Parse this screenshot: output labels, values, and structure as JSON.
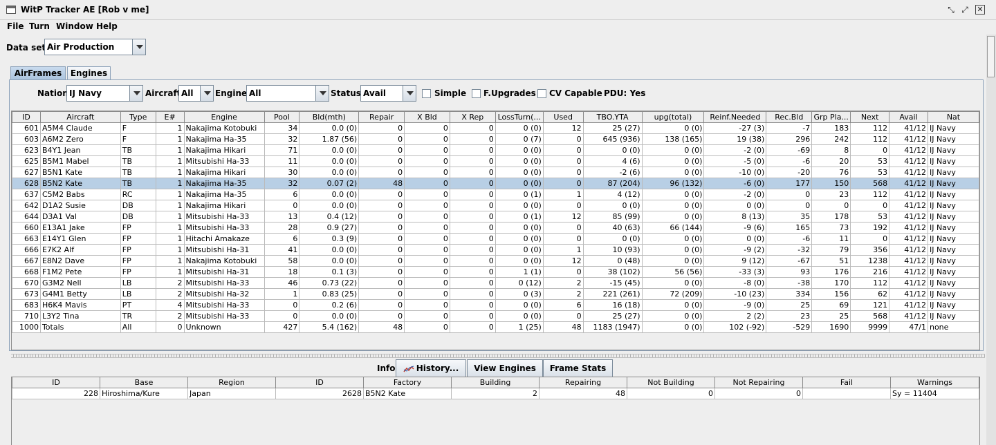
{
  "window": {
    "title": "WitP Tracker AE [Rob v me]"
  },
  "menu": [
    "File",
    "Turn",
    "Window",
    "Help"
  ],
  "dataset": {
    "label": "Data set:",
    "value": "Air Production"
  },
  "tabs": [
    {
      "label": "AirFrames",
      "active": true
    },
    {
      "label": "Engines",
      "active": false
    }
  ],
  "filters": {
    "nation_label": "Nation:",
    "nation_value": "IJ Navy",
    "aircraft_label": "Aircraft:",
    "aircraft_value": "All",
    "engine_label": "Engine:",
    "engine_value": "All",
    "status_label": "Status:",
    "status_value": "Avail",
    "simple_label": "Simple",
    "simple_checked": false,
    "fupgrades_label": "F.Upgrades",
    "fupgrades_checked": false,
    "cvcapable_label": "CV Capable",
    "cvcapable_checked": false,
    "pdu_label": "PDU: Yes"
  },
  "table": {
    "columns": [
      "ID",
      "Aircraft",
      "Type",
      "E#",
      "Engine",
      "Pool",
      "Bld(mth)",
      "Repair",
      "X Bld",
      "X Rep",
      "LossTurn(...",
      "Used",
      "TBO.YTA",
      "upg(total)",
      "Reinf.Needed",
      "Rec.Bld",
      "Grp Pla...",
      "Next",
      "Avail",
      "Nat"
    ],
    "selected_row": 5,
    "rows": [
      [
        "601",
        "A5M4 Claude",
        "F",
        "1",
        "Nakajima Kotobuki",
        "34",
        "0.0 (0)",
        "0",
        "0",
        "0",
        "0 (0)",
        "12",
        "25 (27)",
        "0 (0)",
        "-27 (3)",
        "-7",
        "183",
        "112",
        "41/12",
        "IJ Navy"
      ],
      [
        "603",
        "A6M2 Zero",
        "F",
        "1",
        "Nakajima Ha-35",
        "32",
        "1.87 (56)",
        "0",
        "0",
        "0",
        "0 (7)",
        "0",
        "645 (936)",
        "138 (165)",
        "19 (38)",
        "296",
        "242",
        "112",
        "41/12",
        "IJ Navy"
      ],
      [
        "623",
        "B4Y1 Jean",
        "TB",
        "1",
        "Nakajima Hikari",
        "71",
        "0.0 (0)",
        "0",
        "0",
        "0",
        "0 (0)",
        "0",
        "0 (0)",
        "0 (0)",
        "-2 (0)",
        "-69",
        "8",
        "0",
        "41/12",
        "IJ Navy"
      ],
      [
        "625",
        "B5M1 Mabel",
        "TB",
        "1",
        "Mitsubishi Ha-33",
        "11",
        "0.0 (0)",
        "0",
        "0",
        "0",
        "0 (0)",
        "0",
        "4 (6)",
        "0 (0)",
        "-5 (0)",
        "-6",
        "20",
        "53",
        "41/12",
        "IJ Navy"
      ],
      [
        "627",
        "B5N1 Kate",
        "TB",
        "1",
        "Nakajima Hikari",
        "30",
        "0.0 (0)",
        "0",
        "0",
        "0",
        "0 (0)",
        "0",
        "-2 (6)",
        "0 (0)",
        "-10 (0)",
        "-20",
        "76",
        "53",
        "41/12",
        "IJ Navy"
      ],
      [
        "628",
        "B5N2 Kate",
        "TB",
        "1",
        "Nakajima Ha-35",
        "32",
        "0.07 (2)",
        "48",
        "0",
        "0",
        "0 (0)",
        "0",
        "87 (204)",
        "96 (132)",
        "-6 (0)",
        "177",
        "150",
        "568",
        "41/12",
        "IJ Navy"
      ],
      [
        "637",
        "C5M2 Babs",
        "RC",
        "1",
        "Nakajima Ha-35",
        "6",
        "0.0 (0)",
        "0",
        "0",
        "0",
        "0 (1)",
        "1",
        "4 (12)",
        "0 (0)",
        "-2 (0)",
        "0",
        "23",
        "112",
        "41/12",
        "IJ Navy"
      ],
      [
        "642",
        "D1A2 Susie",
        "DB",
        "1",
        "Nakajima Hikari",
        "0",
        "0.0 (0)",
        "0",
        "0",
        "0",
        "0 (0)",
        "0",
        "0 (0)",
        "0 (0)",
        "0 (0)",
        "0",
        "0",
        "0",
        "41/12",
        "IJ Navy"
      ],
      [
        "644",
        "D3A1 Val",
        "DB",
        "1",
        "Mitsubishi Ha-33",
        "13",
        "0.4 (12)",
        "0",
        "0",
        "0",
        "0 (1)",
        "12",
        "85 (99)",
        "0 (0)",
        "8 (13)",
        "35",
        "178",
        "53",
        "41/12",
        "IJ Navy"
      ],
      [
        "660",
        "E13A1 Jake",
        "FP",
        "1",
        "Mitsubishi Ha-33",
        "28",
        "0.9 (27)",
        "0",
        "0",
        "0",
        "0 (0)",
        "0",
        "40 (63)",
        "66 (144)",
        "-9 (6)",
        "165",
        "73",
        "192",
        "41/12",
        "IJ Navy"
      ],
      [
        "663",
        "E14Y1 Glen",
        "FP",
        "1",
        "Hitachi Amakaze",
        "6",
        "0.3 (9)",
        "0",
        "0",
        "0",
        "0 (0)",
        "0",
        "0 (0)",
        "0 (0)",
        "0 (0)",
        "-6",
        "11",
        "0",
        "41/12",
        "IJ Navy"
      ],
      [
        "666",
        "E7K2 Alf",
        "FP",
        "1",
        "Mitsubishi Ha-31",
        "41",
        "0.0 (0)",
        "0",
        "0",
        "0",
        "0 (0)",
        "1",
        "10 (93)",
        "0 (0)",
        "-9 (2)",
        "-32",
        "79",
        "356",
        "41/12",
        "IJ Navy"
      ],
      [
        "667",
        "E8N2 Dave",
        "FP",
        "1",
        "Nakajima Kotobuki",
        "58",
        "0.0 (0)",
        "0",
        "0",
        "0",
        "0 (0)",
        "12",
        "0 (48)",
        "0 (0)",
        "9 (12)",
        "-67",
        "51",
        "1238",
        "41/12",
        "IJ Navy"
      ],
      [
        "668",
        "F1M2 Pete",
        "FP",
        "1",
        "Mitsubishi Ha-31",
        "18",
        "0.1 (3)",
        "0",
        "0",
        "0",
        "1 (1)",
        "0",
        "38 (102)",
        "56 (56)",
        "-33 (3)",
        "93",
        "176",
        "216",
        "41/12",
        "IJ Navy"
      ],
      [
        "670",
        "G3M2 Nell",
        "LB",
        "2",
        "Mitsubishi Ha-33",
        "46",
        "0.73 (22)",
        "0",
        "0",
        "0",
        "0 (12)",
        "2",
        "-15 (45)",
        "0 (0)",
        "-8 (0)",
        "-38",
        "170",
        "112",
        "41/12",
        "IJ Navy"
      ],
      [
        "673",
        "G4M1 Betty",
        "LB",
        "2",
        "Mitsubishi Ha-32",
        "1",
        "0.83 (25)",
        "0",
        "0",
        "0",
        "0 (3)",
        "2",
        "221 (261)",
        "72 (209)",
        "-10 (23)",
        "334",
        "156",
        "62",
        "41/12",
        "IJ Navy"
      ],
      [
        "683",
        "H6K4 Mavis",
        "PT",
        "4",
        "Mitsubishi Ha-33",
        "0",
        "0.2 (6)",
        "0",
        "0",
        "0",
        "0 (0)",
        "6",
        "16 (18)",
        "0 (0)",
        "-9 (0)",
        "25",
        "69",
        "121",
        "41/12",
        "IJ Navy"
      ],
      [
        "710",
        "L3Y2 Tina",
        "TR",
        "2",
        "Mitsubishi Ha-33",
        "0",
        "0.0 (0)",
        "0",
        "0",
        "0",
        "0 (0)",
        "0",
        "25 (27)",
        "0 (0)",
        "2 (2)",
        "23",
        "25",
        "568",
        "41/12",
        "IJ Navy"
      ],
      [
        "1000",
        "Totals",
        "All",
        "0",
        "Unknown",
        "427",
        "5.4 (162)",
        "48",
        "0",
        "0",
        "1 (25)",
        "48",
        "1183 (1947)",
        "0 (0)",
        "102 (-92)",
        "-529",
        "1690",
        "9999",
        "47/1",
        "none"
      ]
    ]
  },
  "info": {
    "label": "Info:",
    "history_label": "History...",
    "view_engines_label": "View Engines",
    "frame_stats_label": "Frame Stats"
  },
  "bottom_table": {
    "columns": [
      "ID",
      "Base",
      "Region",
      "ID",
      "Factory",
      "Building",
      "Repairing",
      "Not Building",
      "Not Repairing",
      "Fail",
      "Warnings"
    ],
    "rows": [
      [
        "228",
        "Hiroshima/Kure",
        "Japan",
        "2628",
        "B5N2 Kate",
        "2",
        "48",
        "0",
        "0",
        "",
        "Sy = 11404"
      ]
    ]
  }
}
